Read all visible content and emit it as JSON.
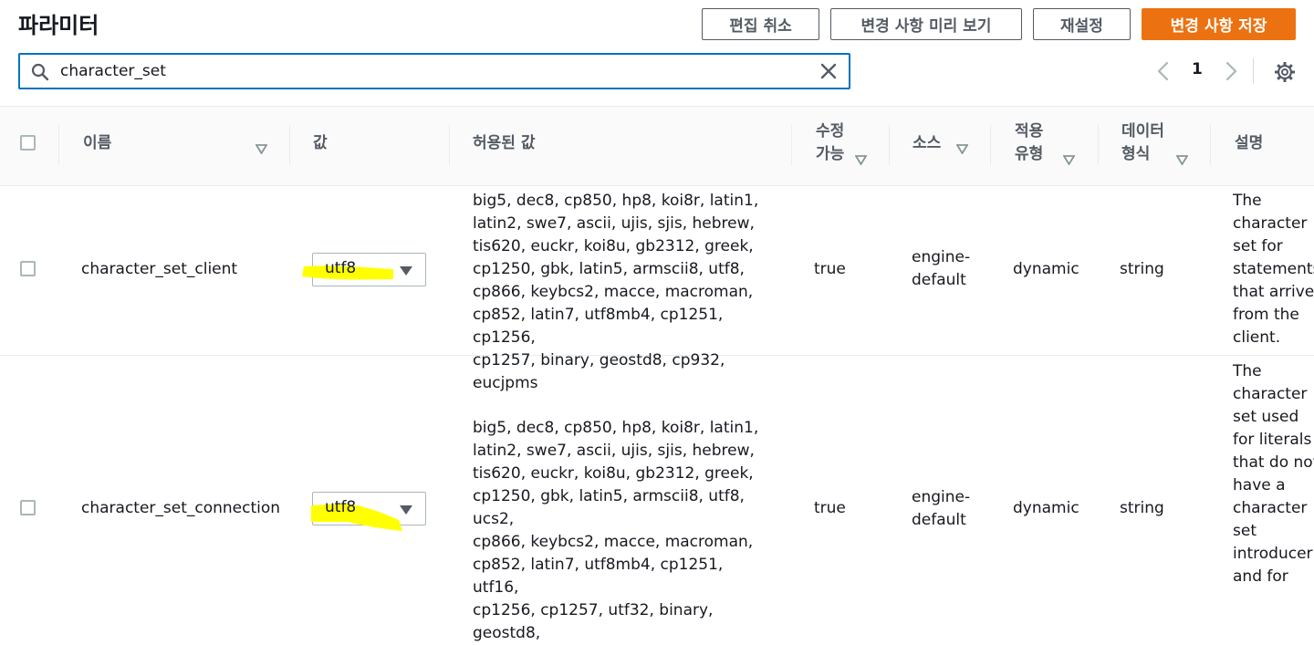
{
  "header": {
    "title": "파라미터",
    "cancel_label": "편집 취소",
    "preview_label": "변경 사항 미리 보기",
    "reset_label": "재설정",
    "save_label": "변경 사항 저장"
  },
  "search": {
    "value": "character_set"
  },
  "pagination": {
    "page": "1"
  },
  "table": {
    "headers": {
      "name": "이름",
      "value": "값",
      "allowed": "허용된 값",
      "modifiable_1": "수정",
      "modifiable_2": "가능",
      "source": "소스",
      "apply_1": "적용",
      "apply_2": "유형",
      "datatype_1": "데이터",
      "datatype_2": "형식",
      "description": "설명"
    },
    "rows": [
      {
        "name": "character_set_client",
        "value": "utf8",
        "allowed": [
          "big5, dec8, cp850, hp8, koi8r, latin1,",
          "latin2, swe7, ascii, ujis, sjis, hebrew,",
          "tis620, euckr, koi8u, gb2312, greek,",
          "cp1250, gbk, latin5, armscii8, utf8,",
          "cp866, keybcs2, macce, macroman,",
          "cp852, latin7, utf8mb4, cp1251, cp1256,",
          "cp1257, binary, geostd8, cp932, eucjpms"
        ],
        "modifiable": "true",
        "source_1": "engine-",
        "source_2": "default",
        "apply_type": "dynamic",
        "data_type": "string",
        "description": [
          "The",
          "character",
          "set for",
          "statements",
          "that arrive",
          "from the",
          "client."
        ]
      },
      {
        "name": "character_set_connection",
        "value": "utf8",
        "allowed": [
          "big5, dec8, cp850, hp8, koi8r, latin1,",
          "latin2, swe7, ascii, ujis, sjis, hebrew,",
          "tis620, euckr, koi8u, gb2312, greek,",
          "cp1250, gbk, latin5, armscii8, utf8, ucs2,",
          "cp866, keybcs2, macce, macroman,",
          "cp852, latin7, utf8mb4, cp1251, utf16,",
          "cp1256, cp1257, utf32, binary, geostd8,"
        ],
        "modifiable": "true",
        "source_1": "engine-",
        "source_2": "default",
        "apply_type": "dynamic",
        "data_type": "string",
        "description": [
          "The",
          "character",
          "set used",
          "for literals",
          "that do not",
          "have a",
          "character",
          "set",
          "introducer",
          "and for"
        ]
      }
    ]
  },
  "colors": {
    "accent": "#ec7211",
    "focus": "#0073bb",
    "highlight": "#ffff00"
  }
}
